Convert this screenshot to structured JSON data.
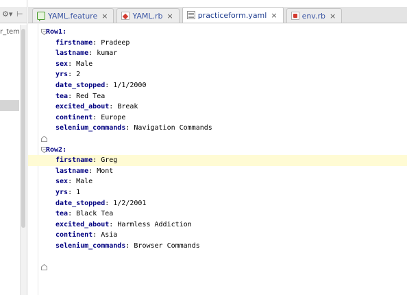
{
  "left_panel": {
    "path_fragment": "r_tem",
    "gear_icon": "gear-icon",
    "collapse_icon": "collapse-icon"
  },
  "tabs": [
    {
      "label": "YAML.feature",
      "icon": "feature-file-icon",
      "active": false
    },
    {
      "label": "YAML.rb",
      "icon": "ruby-file-icon",
      "active": false
    },
    {
      "label": "practiceform.yaml",
      "icon": "yaml-file-icon",
      "active": true
    },
    {
      "label": "env.rb",
      "icon": "ruby-file-icon",
      "active": false
    }
  ],
  "tab_close_glyph": "×",
  "editor": {
    "lines": [
      {
        "key": "Row1",
        "sep": ":",
        "value": "",
        "level": 0,
        "fold": "open"
      },
      {
        "key": "firstname",
        "sep": ": ",
        "value": "Pradeep",
        "level": 1
      },
      {
        "key": "lastname",
        "sep": ": ",
        "value": "kumar",
        "level": 1
      },
      {
        "key": "sex",
        "sep": ": ",
        "value": "Male",
        "level": 1
      },
      {
        "key": "yrs",
        "sep": ": ",
        "value": "2",
        "level": 1
      },
      {
        "key": "date_stopped",
        "sep": ": ",
        "value": "1/1/2000",
        "level": 1
      },
      {
        "key": "tea",
        "sep": ": ",
        "value": "Red Tea",
        "level": 1
      },
      {
        "key": "excited_about",
        "sep": ": ",
        "value": "Break",
        "level": 1
      },
      {
        "key": "continent",
        "sep": ": ",
        "value": "Europe",
        "level": 1
      },
      {
        "key": "selenium_commands",
        "sep": ": ",
        "value": "Navigation Commands",
        "level": 1
      },
      {
        "key": "",
        "sep": "",
        "value": "",
        "level": 0,
        "fold": "end"
      },
      {
        "key": "Row2",
        "sep": ":",
        "value": "",
        "level": 0,
        "fold": "open"
      },
      {
        "key": "firstname",
        "sep": ": ",
        "value": "Greg",
        "level": 1,
        "current": true
      },
      {
        "key": "lastname",
        "sep": ": ",
        "value": "Mont",
        "level": 1
      },
      {
        "key": "sex",
        "sep": ": ",
        "value": "Male",
        "level": 1
      },
      {
        "key": "yrs",
        "sep": ": ",
        "value": "1",
        "level": 1
      },
      {
        "key": "date_stopped",
        "sep": ": ",
        "value": "1/2/2001",
        "level": 1
      },
      {
        "key": "tea",
        "sep": ": ",
        "value": "Black Tea",
        "level": 1
      },
      {
        "key": "excited_about",
        "sep": ": ",
        "value": "Harmless Addiction",
        "level": 1
      },
      {
        "key": "continent",
        "sep": ": ",
        "value": "Asia",
        "level": 1
      },
      {
        "key": "selenium_commands",
        "sep": ": ",
        "value": "Browser Commands",
        "level": 1
      },
      {
        "key": "",
        "sep": "",
        "value": "",
        "level": 0
      },
      {
        "key": "",
        "sep": "",
        "value": "",
        "level": 0,
        "fold": "end"
      }
    ]
  },
  "colors": {
    "key": "#000080",
    "current_line": "#fffbd4",
    "tab_text": "#3a55a4"
  }
}
